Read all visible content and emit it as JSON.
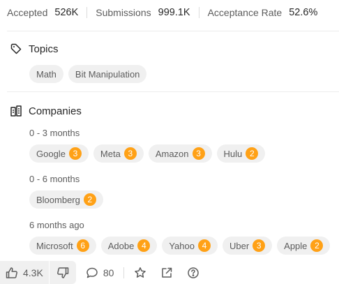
{
  "stats": {
    "accepted_label": "Accepted",
    "accepted_value": "526K",
    "submissions_label": "Submissions",
    "submissions_value": "999.1K",
    "acceptance_label": "Acceptance Rate",
    "acceptance_value": "52.6%"
  },
  "topics": {
    "title": "Topics",
    "icon": "tag-icon",
    "tags": [
      "Math",
      "Bit Manipulation"
    ]
  },
  "companies": {
    "title": "Companies",
    "icon": "building-icon",
    "groups": [
      {
        "period": "0 - 3 months",
        "items": [
          {
            "name": "Google",
            "count": "3"
          },
          {
            "name": "Meta",
            "count": "3"
          },
          {
            "name": "Amazon",
            "count": "3"
          },
          {
            "name": "Hulu",
            "count": "2"
          }
        ]
      },
      {
        "period": "0 - 6 months",
        "items": [
          {
            "name": "Bloomberg",
            "count": "2"
          }
        ]
      },
      {
        "period": "6 months ago",
        "items": [
          {
            "name": "Microsoft",
            "count": "6"
          },
          {
            "name": "Adobe",
            "count": "4"
          },
          {
            "name": "Yahoo",
            "count": "4"
          },
          {
            "name": "Uber",
            "count": "3"
          },
          {
            "name": "Apple",
            "count": "2"
          }
        ]
      }
    ]
  },
  "footer": {
    "likes": "4.3K",
    "comments": "80"
  },
  "colors": {
    "badge": "#ffa116",
    "chip_bg": "#f0f0f0",
    "text": "#262626",
    "muted": "#5c5c5c"
  }
}
